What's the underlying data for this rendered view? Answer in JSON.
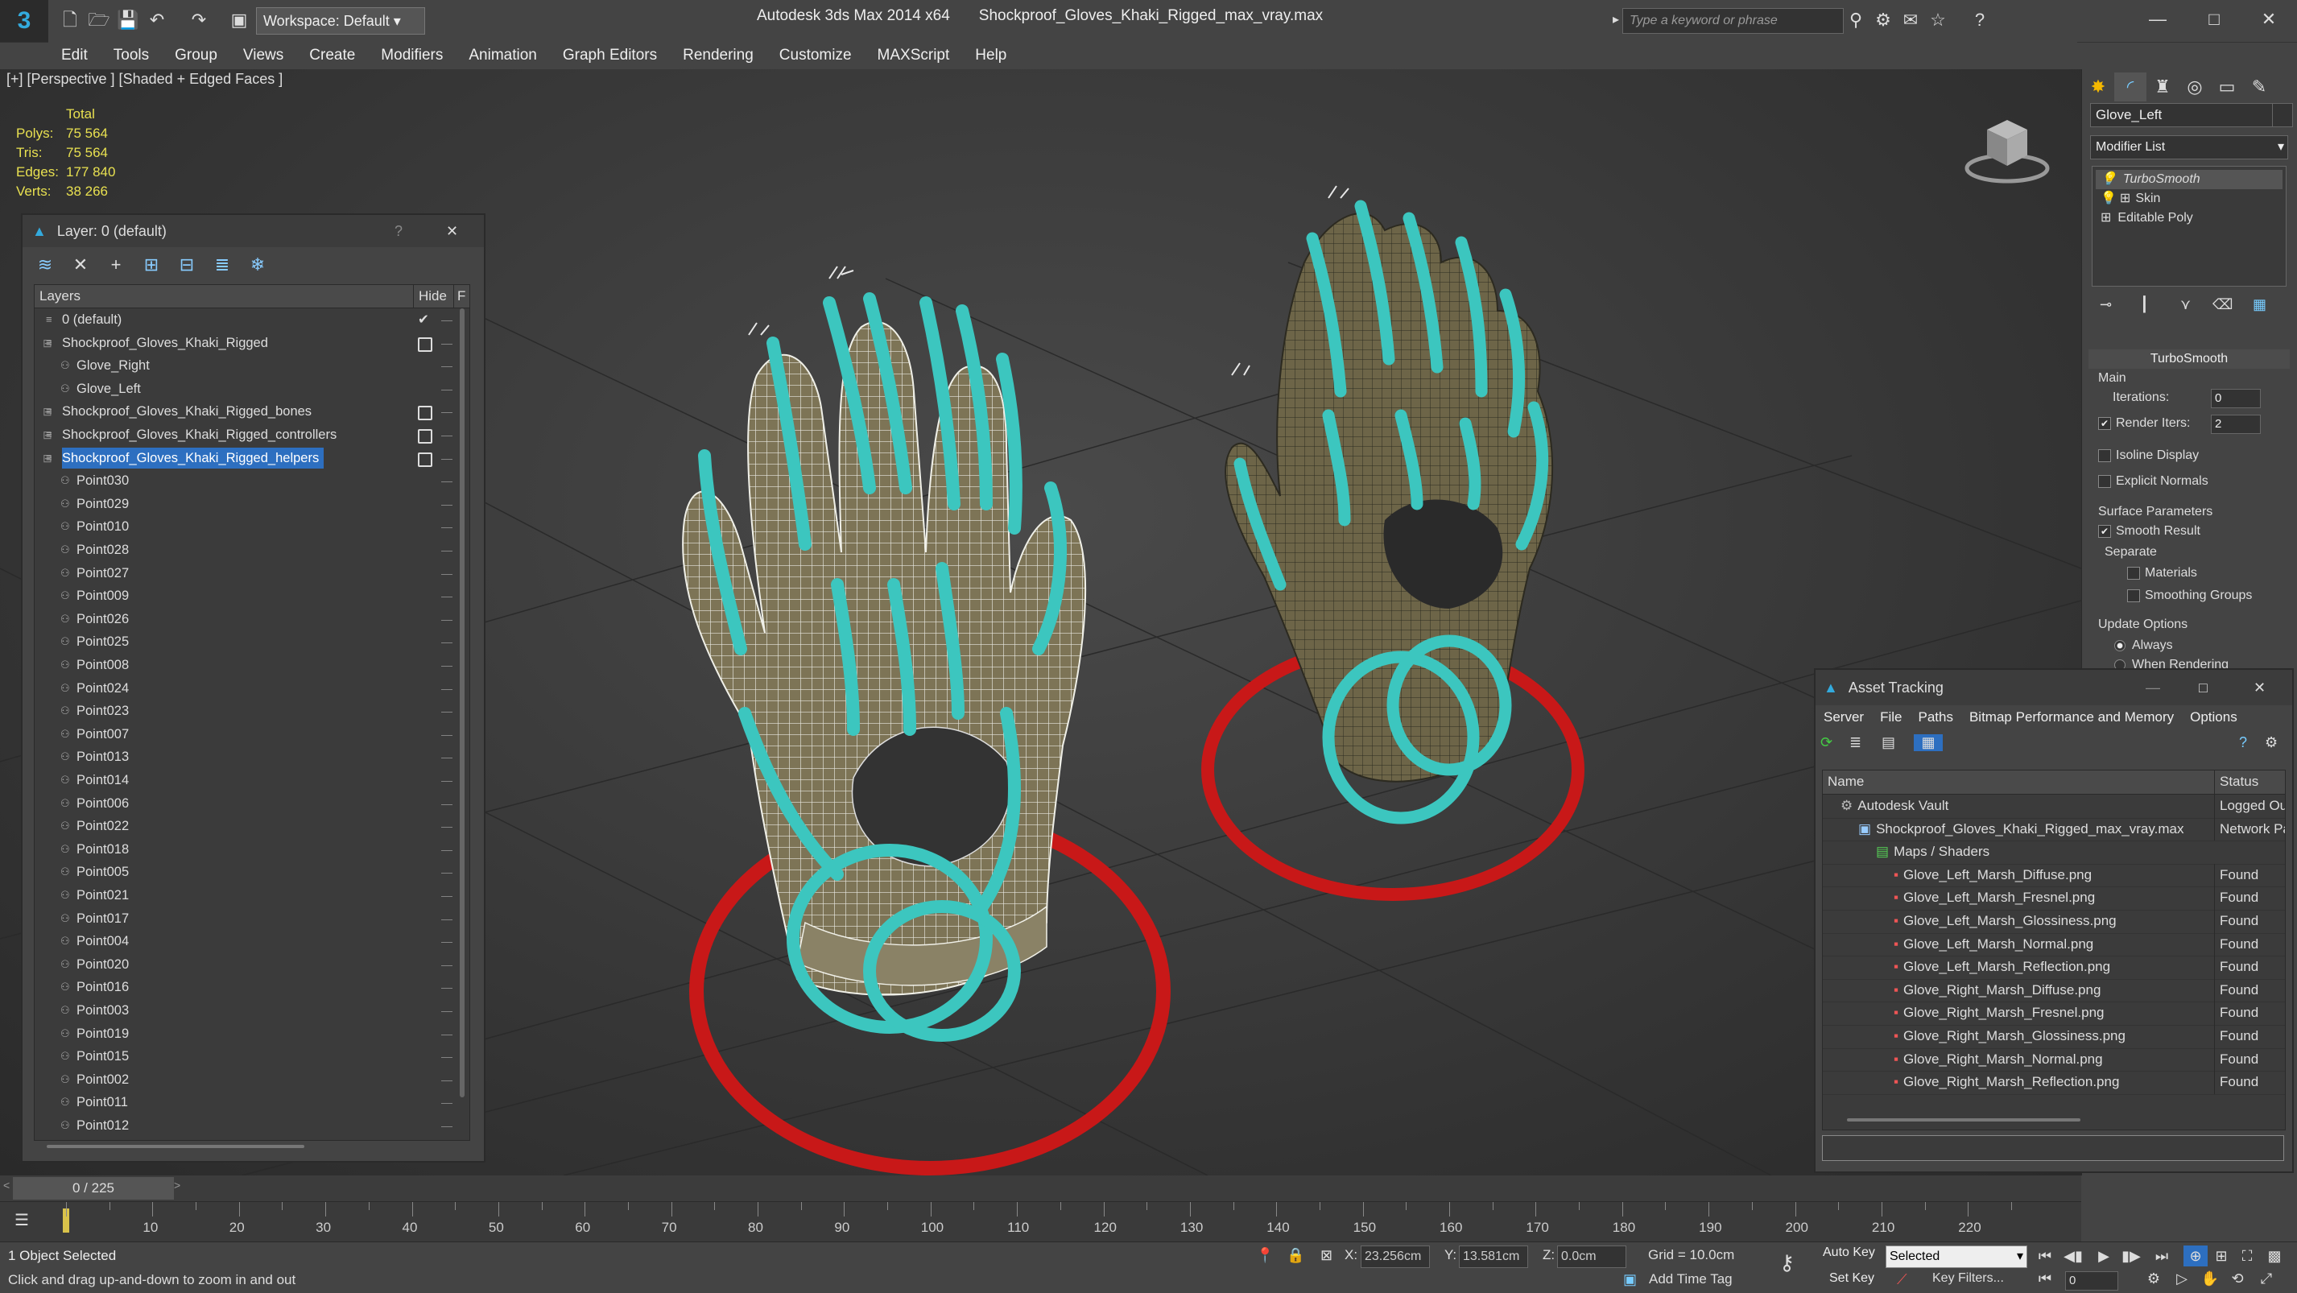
{
  "app": {
    "title": "Autodesk 3ds Max  2014 x64",
    "file": "Shockproof_Gloves_Khaki_Rigged_max_vray.max",
    "workspace": "Workspace: Default",
    "search_placeholder": "Type a keyword or phrase"
  },
  "menu": [
    "Edit",
    "Tools",
    "Group",
    "Views",
    "Create",
    "Modifiers",
    "Animation",
    "Graph Editors",
    "Rendering",
    "Customize",
    "MAXScript",
    "Help"
  ],
  "viewport": {
    "label": "[+] [Perspective ] [Shaded + Edged Faces ]",
    "stats": {
      "header": "Total",
      "polys_label": "Polys:",
      "polys": "75 564",
      "tris_label": "Tris:",
      "tris": "75 564",
      "edges_label": "Edges:",
      "edges": "177 840",
      "verts_label": "Verts:",
      "verts": "38 266"
    }
  },
  "layer_dialog": {
    "title": "Layer: 0 (default)",
    "help": "?",
    "close": "✕",
    "col_layers": "Layers",
    "col_hide": "Hide",
    "col_freeze": "F",
    "rows": [
      {
        "name": "0 (default)",
        "type": "layer",
        "depth": 0,
        "check": true
      },
      {
        "name": "Shockproof_Gloves_Khaki_Rigged",
        "type": "layer",
        "depth": 0,
        "box": true
      },
      {
        "name": "Glove_Right",
        "type": "object",
        "depth": 1
      },
      {
        "name": "Glove_Left",
        "type": "object",
        "depth": 1
      },
      {
        "name": "Shockproof_Gloves_Khaki_Rigged_bones",
        "type": "layer",
        "depth": 0,
        "box": true
      },
      {
        "name": "Shockproof_Gloves_Khaki_Rigged_controllers",
        "type": "layer",
        "depth": 0,
        "box": true
      },
      {
        "name": "Shockproof_Gloves_Khaki_Rigged_helpers",
        "type": "layer",
        "depth": 0,
        "box": true,
        "selected": true
      },
      {
        "name": "Point030",
        "type": "object",
        "depth": 1
      },
      {
        "name": "Point029",
        "type": "object",
        "depth": 1
      },
      {
        "name": "Point010",
        "type": "object",
        "depth": 1
      },
      {
        "name": "Point028",
        "type": "object",
        "depth": 1
      },
      {
        "name": "Point027",
        "type": "object",
        "depth": 1
      },
      {
        "name": "Point009",
        "type": "object",
        "depth": 1
      },
      {
        "name": "Point026",
        "type": "object",
        "depth": 1
      },
      {
        "name": "Point025",
        "type": "object",
        "depth": 1
      },
      {
        "name": "Point008",
        "type": "object",
        "depth": 1
      },
      {
        "name": "Point024",
        "type": "object",
        "depth": 1
      },
      {
        "name": "Point023",
        "type": "object",
        "depth": 1
      },
      {
        "name": "Point007",
        "type": "object",
        "depth": 1
      },
      {
        "name": "Point013",
        "type": "object",
        "depth": 1
      },
      {
        "name": "Point014",
        "type": "object",
        "depth": 1
      },
      {
        "name": "Point006",
        "type": "object",
        "depth": 1
      },
      {
        "name": "Point022",
        "type": "object",
        "depth": 1
      },
      {
        "name": "Point018",
        "type": "object",
        "depth": 1
      },
      {
        "name": "Point005",
        "type": "object",
        "depth": 1
      },
      {
        "name": "Point021",
        "type": "object",
        "depth": 1
      },
      {
        "name": "Point017",
        "type": "object",
        "depth": 1
      },
      {
        "name": "Point004",
        "type": "object",
        "depth": 1
      },
      {
        "name": "Point020",
        "type": "object",
        "depth": 1
      },
      {
        "name": "Point016",
        "type": "object",
        "depth": 1
      },
      {
        "name": "Point003",
        "type": "object",
        "depth": 1
      },
      {
        "name": "Point019",
        "type": "object",
        "depth": 1
      },
      {
        "name": "Point015",
        "type": "object",
        "depth": 1
      },
      {
        "name": "Point002",
        "type": "object",
        "depth": 1
      },
      {
        "name": "Point011",
        "type": "object",
        "depth": 1
      },
      {
        "name": "Point012",
        "type": "object",
        "depth": 1
      }
    ]
  },
  "command_panel": {
    "object_name": "Glove_Left",
    "modifier_list": "Modifier List",
    "stack": [
      "TurboSmooth",
      "Skin",
      "Editable Poly"
    ],
    "rollout": "TurboSmooth",
    "main": "Main",
    "iterations_label": "Iterations:",
    "iterations": "0",
    "render_iters_label": "Render Iters:",
    "render_iters": "2",
    "isoline": "Isoline Display",
    "explicit": "Explicit Normals",
    "surface": "Surface Parameters",
    "smooth_result": "Smooth Result",
    "separate": "Separate",
    "materials": "Materials",
    "smoothing_groups": "Smoothing Groups",
    "update_options": "Update Options",
    "always": "Always",
    "when_rendering": "When Rendering"
  },
  "asset_tracking": {
    "title": "Asset Tracking",
    "menu": [
      "Server",
      "File",
      "Paths",
      "Bitmap Performance and Memory",
      "Options"
    ],
    "col_name": "Name",
    "col_status": "Status",
    "rows": [
      {
        "name": "Autodesk Vault",
        "status": "Logged Ou",
        "indent": 1,
        "icon": "vault"
      },
      {
        "name": "Shockproof_Gloves_Khaki_Rigged_max_vray.max",
        "status": "Network Pa",
        "indent": 2,
        "icon": "max"
      },
      {
        "name": "Maps / Shaders",
        "status": "",
        "indent": 3,
        "icon": "maps"
      },
      {
        "name": "Glove_Left_Marsh_Diffuse.png",
        "status": "Found",
        "indent": 4,
        "icon": "png"
      },
      {
        "name": "Glove_Left_Marsh_Fresnel.png",
        "status": "Found",
        "indent": 4,
        "icon": "png"
      },
      {
        "name": "Glove_Left_Marsh_Glossiness.png",
        "status": "Found",
        "indent": 4,
        "icon": "png"
      },
      {
        "name": "Glove_Left_Marsh_Normal.png",
        "status": "Found",
        "indent": 4,
        "icon": "png"
      },
      {
        "name": "Glove_Left_Marsh_Reflection.png",
        "status": "Found",
        "indent": 4,
        "icon": "png"
      },
      {
        "name": "Glove_Right_Marsh_Diffuse.png",
        "status": "Found",
        "indent": 4,
        "icon": "png"
      },
      {
        "name": "Glove_Right_Marsh_Fresnel.png",
        "status": "Found",
        "indent": 4,
        "icon": "png"
      },
      {
        "name": "Glove_Right_Marsh_Glossiness.png",
        "status": "Found",
        "indent": 4,
        "icon": "png"
      },
      {
        "name": "Glove_Right_Marsh_Normal.png",
        "status": "Found",
        "indent": 4,
        "icon": "png"
      },
      {
        "name": "Glove_Right_Marsh_Reflection.png",
        "status": "Found",
        "indent": 4,
        "icon": "png"
      }
    ]
  },
  "timeline": {
    "frame": "0 / 225",
    "ticks": [
      "10",
      "20",
      "30",
      "40",
      "50",
      "60",
      "70",
      "80",
      "90",
      "100",
      "110",
      "120",
      "130",
      "140",
      "150",
      "160",
      "170",
      "180",
      "190",
      "200",
      "210",
      "220"
    ]
  },
  "status": {
    "selection": "1 Object Selected",
    "prompt": "Click and drag up-and-down to zoom in and out",
    "x_label": "X:",
    "x": "23.256cm",
    "y_label": "Y:",
    "y": "13.581cm",
    "z_label": "Z:",
    "z": "0.0cm",
    "grid": "Grid = 10.0cm",
    "add_time_tag": "Add Time Tag",
    "auto_key": "Auto Key",
    "set_key": "Set Key",
    "selected": "Selected",
    "key_filters": "Key Filters...",
    "frame_value": "0"
  },
  "colors": {
    "accent": "#2d6fc0",
    "teal_controls": "#3cc6bf",
    "red_controls": "#d61d1d",
    "glove": "#7d7456",
    "stats_text": "#e8e050"
  }
}
